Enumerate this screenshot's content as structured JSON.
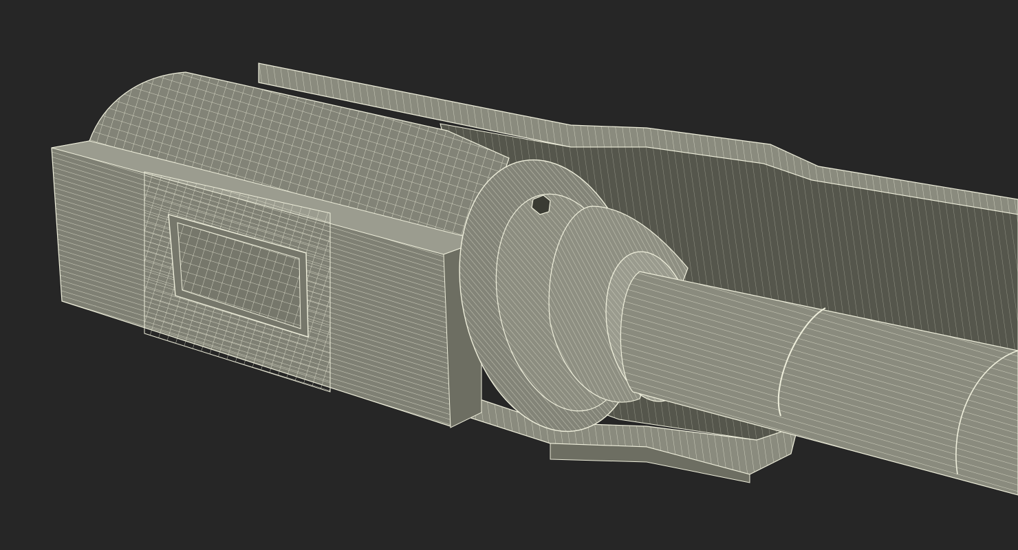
{
  "scene": {
    "subject": "wireframe-cutaway-mechanical-part",
    "colors": {
      "background": "#262626",
      "surface": "#7f8074",
      "surface_dark": "#5c5d53",
      "surface_light": "#9b9c8f",
      "wire": "#efefdc",
      "interior": "#55564c"
    }
  }
}
